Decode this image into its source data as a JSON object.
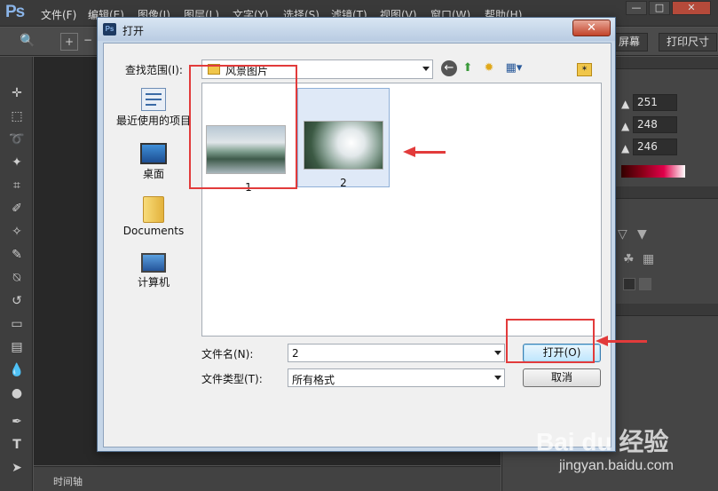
{
  "app": {
    "logo": "Ps",
    "menus": [
      "文件(F)",
      "编辑(E)",
      "图像(I)",
      "图层(L)",
      "文字(Y)",
      "选择(S)",
      "滤镜(T)",
      "视图(V)",
      "窗口(W)",
      "帮助(H)"
    ],
    "window_buttons": [
      "—",
      "□",
      "✕"
    ],
    "options_bar": {
      "fill_screen_button": "屏幕",
      "print_size_button": "打印尺寸"
    },
    "timeline_label": "时间轴",
    "color_panel": {
      "values": [
        "251",
        "248",
        "246"
      ]
    }
  },
  "dialog": {
    "title": "打开",
    "close_glyph": "✕",
    "look_in_label": "查找范围(I):",
    "look_in_value": "风景图片",
    "places": [
      {
        "label": "最近使用的项目",
        "icon": "recent-items-icon"
      },
      {
        "label": "桌面",
        "icon": "desktop-icon"
      },
      {
        "label": "Documents",
        "icon": "folder-icon"
      },
      {
        "label": "计算机",
        "icon": "computer-icon"
      }
    ],
    "files": [
      {
        "name": "1",
        "selected": false
      },
      {
        "name": "2",
        "selected": true
      }
    ],
    "file_name_label": "文件名(N):",
    "file_name_value": "2",
    "file_type_label": "文件类型(T):",
    "file_type_value": "所有格式",
    "open_button": "打开(O)",
    "cancel_button": "取消"
  },
  "watermark": {
    "logo": "Bai du 经验",
    "url": "jingyan.baidu.com"
  },
  "colors": {
    "highlight": "#e23b3b",
    "dialog_frame": "#c6d6e8",
    "ps_dark": "#3a3a3a"
  }
}
